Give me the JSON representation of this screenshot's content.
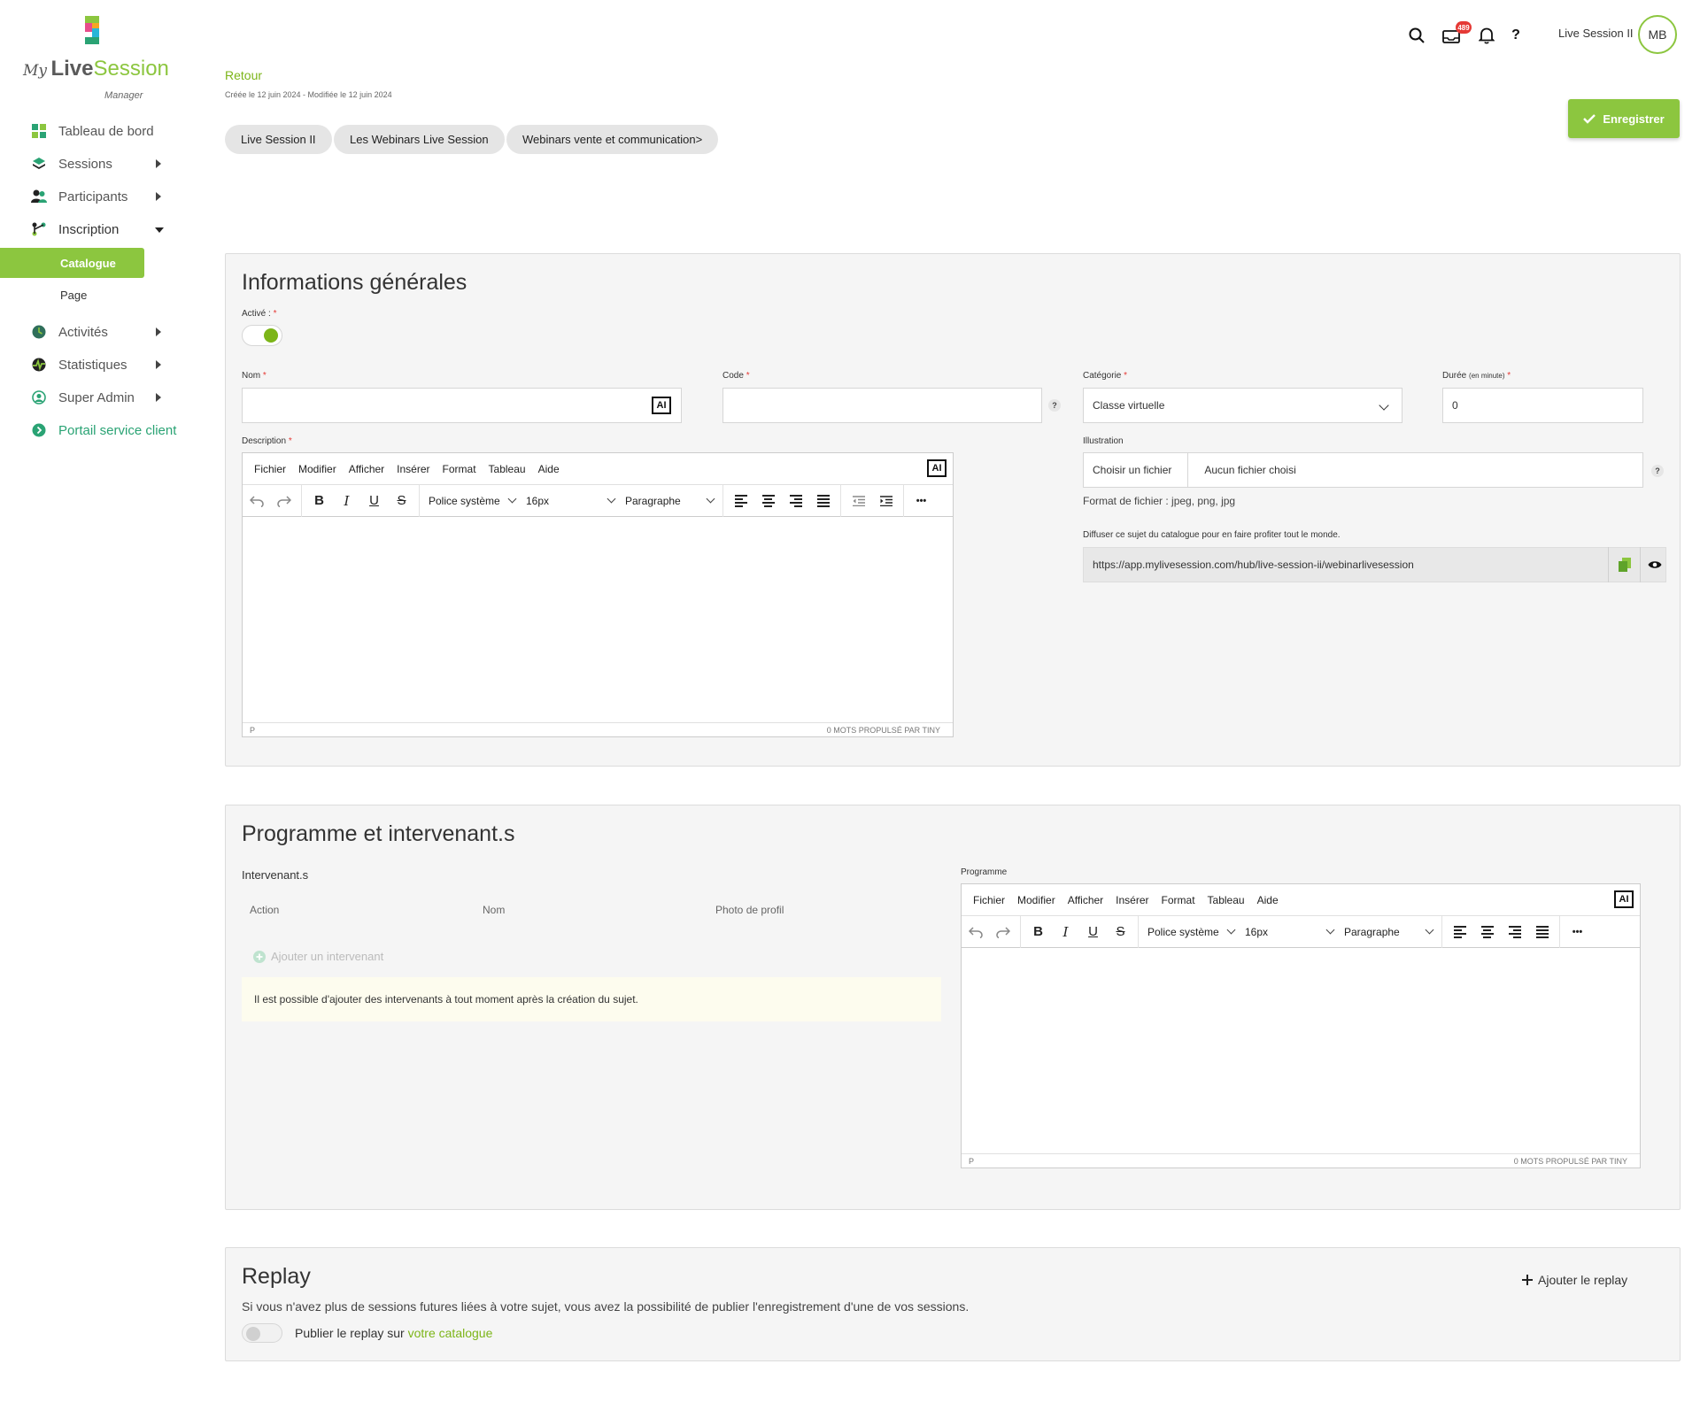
{
  "brand": {
    "my": "My",
    "live": "Live",
    "session": "Session",
    "manager": "Manager",
    "colors": {
      "accent": "#8cc63f",
      "accent_dark": "#7cb518",
      "support": "#2aa374",
      "badge": "#e53935"
    }
  },
  "sidebar": {
    "items": [
      {
        "label": "Tableau de bord",
        "icon": "dashboard-icon"
      },
      {
        "label": "Sessions",
        "icon": "layers-icon"
      },
      {
        "label": "Participants",
        "icon": "users-icon"
      },
      {
        "label": "Inscription",
        "icon": "flow-icon"
      },
      {
        "label": "Activités",
        "icon": "clock-icon"
      },
      {
        "label": "Statistiques",
        "icon": "chart-icon"
      },
      {
        "label": "Super Admin",
        "icon": "admin-icon"
      },
      {
        "label": "Portail service client",
        "icon": "support-icon"
      }
    ],
    "sub_items": [
      {
        "label": "Catalogue",
        "active": true
      },
      {
        "label": "Page",
        "active": false
      }
    ]
  },
  "topbar": {
    "notification_count": "489",
    "help": "?",
    "user_name": "Live Session II",
    "user_initials": "MB"
  },
  "header": {
    "back": "Retour",
    "dates": "Créée le 12 juin 2024 - Modifiée le 12 juin 2024",
    "breadcrumbs": [
      "Live Session II",
      "Les Webinars Live Session",
      "Webinars vente et communication>"
    ],
    "save": "Enregistrer"
  },
  "general": {
    "title": "Informations générales",
    "active_label": "Activé :",
    "required_mark": "*",
    "name_label": "Nom",
    "code_label": "Code",
    "category_label": "Catégorie",
    "category_value": "Classe virtuelle",
    "duration_label": "Durée",
    "duration_unit": "(en minute)",
    "duration_value": "0",
    "description_label": "Description",
    "illustration_label": "Illustration",
    "file_button": "Choisir un fichier",
    "file_status": "Aucun fichier choisi",
    "file_format": "Format de fichier : jpeg, png, jpg",
    "share_label": "Diffuser ce sujet du catalogue pour en faire profiter tout le monde.",
    "share_url": "https://app.mylivesession.com/hub/live-session-ii/webinarlivesession",
    "ai": "AI",
    "help": "?"
  },
  "editor": {
    "menus": [
      "Fichier",
      "Modifier",
      "Afficher",
      "Insérer",
      "Format",
      "Tableau",
      "Aide"
    ],
    "font": "Police système",
    "size": "16px",
    "block": "Paragraphe",
    "bold": "B",
    "italic": "I",
    "underline": "U",
    "strike": "S",
    "more": "•••",
    "status_left": "P",
    "status_right": "0 MOTS  PROPULSÉ PAR TINY"
  },
  "programme": {
    "title": "Programme et intervenant.s",
    "speakers_label": "Intervenant.s",
    "columns": [
      "Action",
      "Nom",
      "Photo de profil"
    ],
    "add_speaker": "Ajouter un intervenant",
    "notice": "Il est possible d'ajouter des intervenants à tout moment après la création du sujet.",
    "programme_label": "Programme"
  },
  "replay": {
    "title": "Replay",
    "add": "Ajouter le replay",
    "description": "Si vous n'avez plus de sessions futures liées à votre sujet, vous avez la possibilité de publier l'enregistrement d'une de vos sessions.",
    "publish_prefix": "Publier le replay sur",
    "publish_link": "votre catalogue"
  }
}
